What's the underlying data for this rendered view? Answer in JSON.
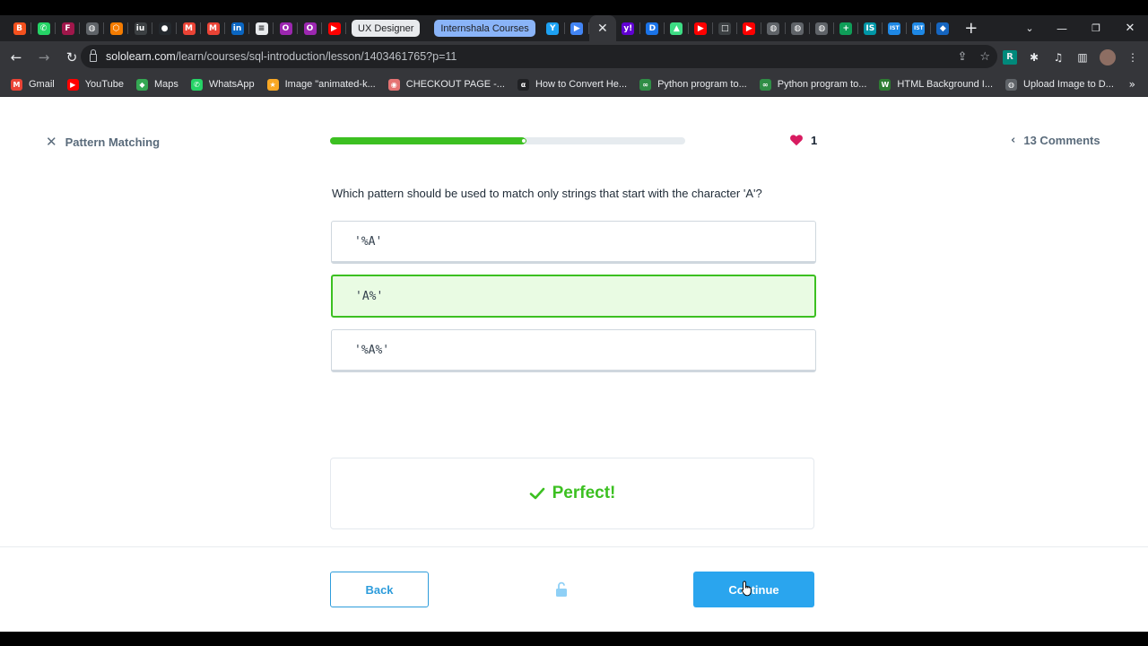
{
  "browser": {
    "tabs": [
      {
        "icon": "blogger-icon",
        "color": "#f4511e",
        "glyph": "B"
      },
      {
        "icon": "whatsapp-icon",
        "color": "#25d366",
        "glyph": "✆"
      },
      {
        "icon": "figma-like-icon",
        "color": "#a0174b",
        "glyph": "F"
      },
      {
        "icon": "globe-icon",
        "color": "#5f6368",
        "glyph": "◍"
      },
      {
        "icon": "hexagon-icon",
        "color": "#f57c00",
        "glyph": "⬡"
      },
      {
        "icon": "iu-icon",
        "color": "#3c4043",
        "glyph": "iu"
      },
      {
        "icon": "github-icon",
        "color": "#24292e",
        "glyph": "●"
      },
      {
        "icon": "gmail-icon",
        "color": "#ea4335",
        "glyph": "M"
      },
      {
        "icon": "gmail-icon",
        "color": "#ea4335",
        "glyph": "M"
      },
      {
        "icon": "linkedin-icon",
        "color": "#0a66c2",
        "glyph": "in"
      },
      {
        "icon": "page-icon",
        "color": "#e8eaed",
        "glyph": "≡"
      },
      {
        "icon": "o-icon",
        "color": "#9c27b0",
        "glyph": "O"
      },
      {
        "icon": "o-icon",
        "color": "#9c27b0",
        "glyph": "O"
      },
      {
        "icon": "youtube-icon",
        "color": "#ff0000",
        "glyph": "▶"
      }
    ],
    "group_tags": [
      {
        "label": "UX Designer",
        "bg": "#e8eaed",
        "fg": "#202124"
      },
      {
        "label": "Internshala Courses",
        "bg": "#8ab4f8",
        "fg": "#202124"
      }
    ],
    "tabs_after": [
      {
        "icon": "y-icon",
        "color": "#1da1f2",
        "glyph": "Y"
      },
      {
        "icon": "play-icon",
        "color": "#4285f4",
        "glyph": "▶"
      }
    ],
    "tabs_end": [
      {
        "icon": "yahoo-icon",
        "color": "#6001d2",
        "glyph": "y!"
      },
      {
        "icon": "d-icon",
        "color": "#1a73e8",
        "glyph": "D"
      },
      {
        "icon": "android-icon",
        "color": "#3ddc84",
        "glyph": "▲"
      },
      {
        "icon": "youtube-icon",
        "color": "#ff0000",
        "glyph": "▶"
      },
      {
        "icon": "square-icon",
        "color": "#3c4043",
        "glyph": "□"
      },
      {
        "icon": "youtube-icon",
        "color": "#ff0000",
        "glyph": "▶"
      },
      {
        "icon": "globe-icon",
        "color": "#5f6368",
        "glyph": "◍"
      },
      {
        "icon": "globe-icon",
        "color": "#5f6368",
        "glyph": "◍"
      },
      {
        "icon": "globe-icon",
        "color": "#5f6368",
        "glyph": "◍"
      },
      {
        "icon": "sheets-icon",
        "color": "#0f9d58",
        "glyph": "+"
      },
      {
        "icon": "is-icon",
        "color": "#0097a7",
        "glyph": "IS"
      },
      {
        "icon": "ist-icon",
        "color": "#1e88e5",
        "glyph": "IST"
      },
      {
        "icon": "ist-icon",
        "color": "#1e88e5",
        "glyph": "IST"
      },
      {
        "icon": "shield-icon",
        "color": "#1565c0",
        "glyph": "◆"
      }
    ],
    "url_host": "sololearn.com",
    "url_path": "/learn/courses/sql-introduction/lesson/1403461765?p=11",
    "bookmarks": [
      {
        "label": "Gmail",
        "icon": "gmail-icon",
        "color": "#ea4335",
        "glyph": "M"
      },
      {
        "label": "YouTube",
        "icon": "youtube-icon",
        "color": "#ff0000",
        "glyph": "▶"
      },
      {
        "label": "Maps",
        "icon": "maps-icon",
        "color": "#34a853",
        "glyph": "◆"
      },
      {
        "label": "WhatsApp",
        "icon": "whatsapp-icon",
        "color": "#25d366",
        "glyph": "✆"
      },
      {
        "label": "Image \"animated-k...",
        "icon": "star-icon",
        "color": "#f9a825",
        "glyph": "★"
      },
      {
        "label": "CHECKOUT PAGE -...",
        "icon": "lips-icon",
        "color": "#e57373",
        "glyph": "◉"
      },
      {
        "label": "How to Convert He...",
        "icon": "alpha-icon",
        "color": "#202124",
        "glyph": "α"
      },
      {
        "label": "Python program to...",
        "icon": "gfg-icon",
        "color": "#2f8d46",
        "glyph": "∞"
      },
      {
        "label": "Python program to...",
        "icon": "gfg-icon",
        "color": "#2f8d46",
        "glyph": "∞"
      },
      {
        "label": "HTML Background I...",
        "icon": "w-icon",
        "color": "#2e7d32",
        "glyph": "W"
      },
      {
        "label": "Upload Image to D...",
        "icon": "globe-icon",
        "color": "#5f6368",
        "glyph": "◍"
      }
    ],
    "bookmarks_more": "»"
  },
  "lesson": {
    "title": "Pattern Matching",
    "progress": 0.55,
    "hearts": "1",
    "comments": "13 Comments"
  },
  "question": {
    "text": "Which pattern should be used to match only strings that start with the character 'A'?",
    "options": [
      "'%A'",
      "'A%'",
      "'%A%'"
    ],
    "selected_index": 1
  },
  "feedback": {
    "text": "Perfect!"
  },
  "footer": {
    "back_label": "Back",
    "continue_label": "Continue"
  },
  "colors": {
    "accent_green": "#3cc021",
    "accent_blue": "#2aa5ee",
    "heart": "#d81b60"
  }
}
